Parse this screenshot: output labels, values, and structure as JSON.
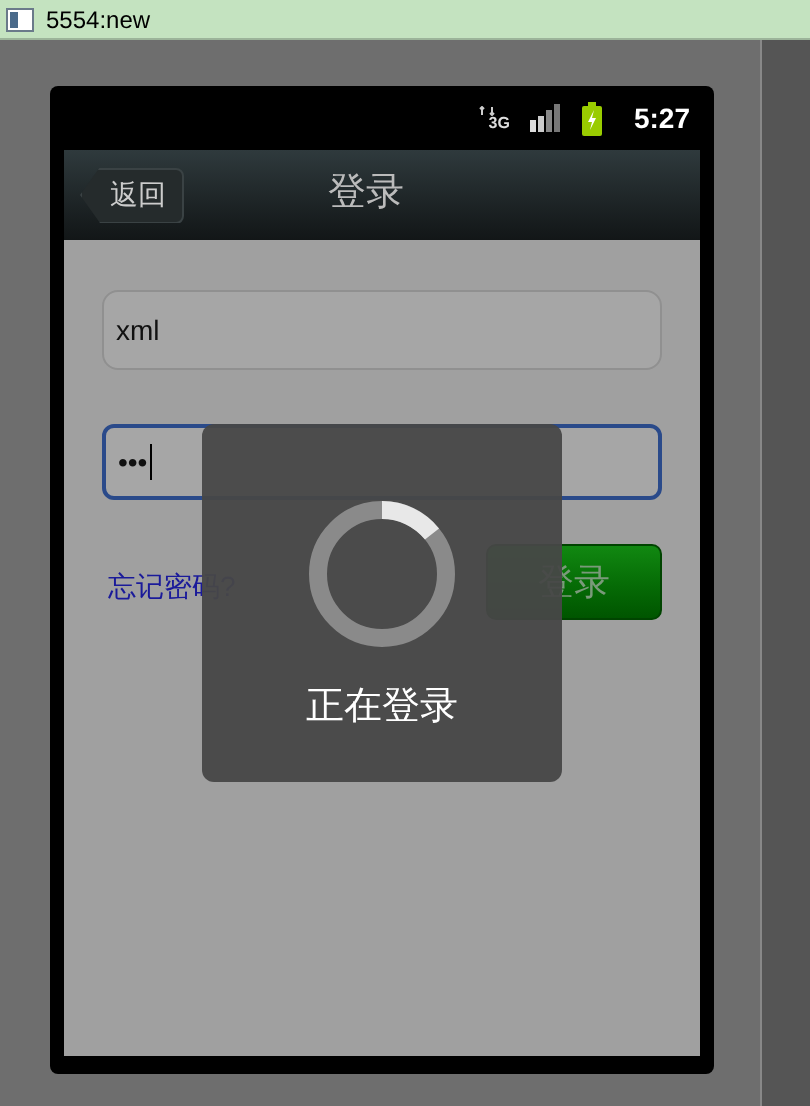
{
  "window": {
    "title": "5554:new"
  },
  "status_bar": {
    "network": "3G",
    "time": "5:27"
  },
  "header": {
    "back": "返回",
    "title": "登录"
  },
  "form": {
    "username": "xml",
    "password": "•••",
    "password_focused": true,
    "forgot_link": "忘记密码?",
    "login_button": "登录"
  },
  "progress_dialog": {
    "message": "正在登录"
  }
}
